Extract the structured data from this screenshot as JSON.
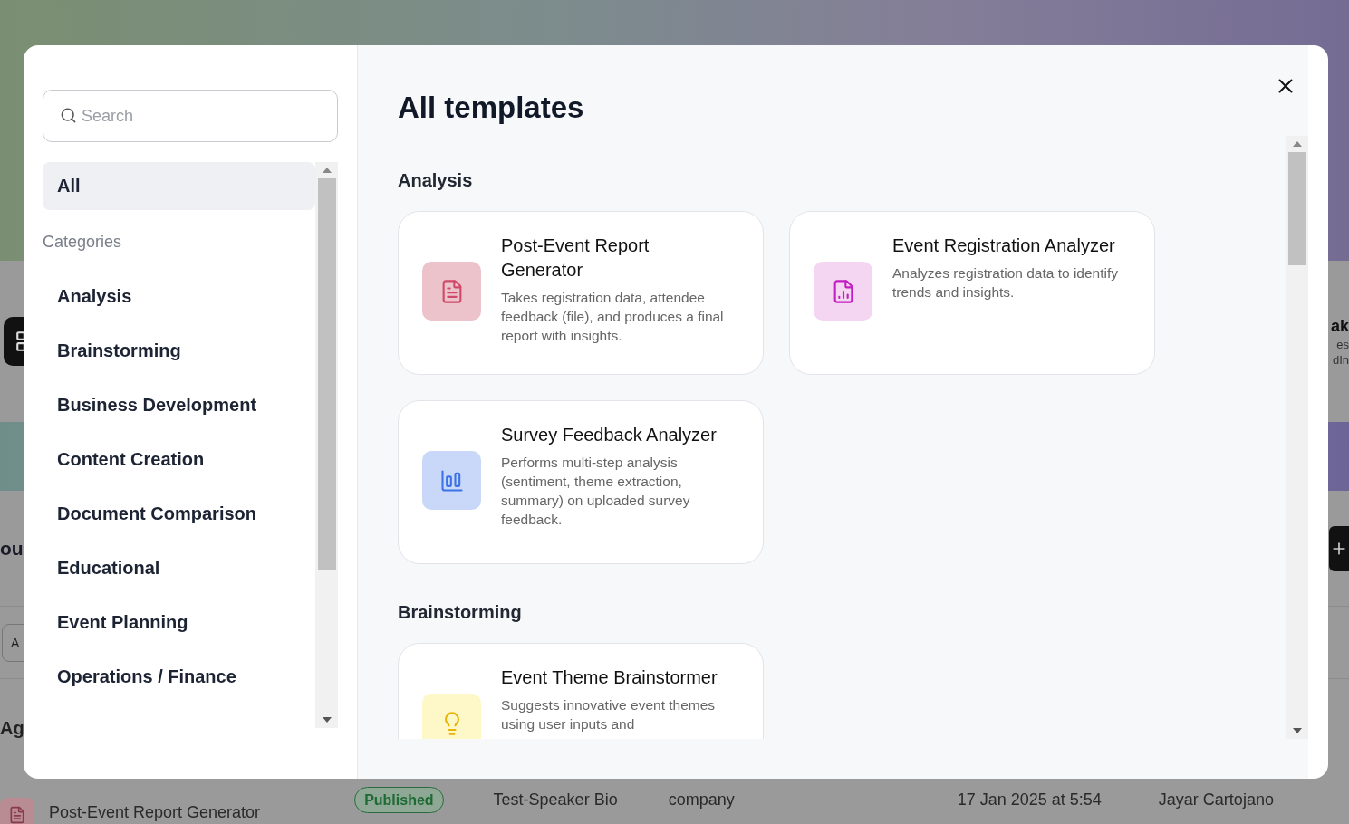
{
  "background": {
    "side_fragments": {
      "right_heading": "ak",
      "right_line_1": "es",
      "right_line_2": "dIn",
      "left_heading": "ou",
      "left_field": "A",
      "left_label": "Ag"
    },
    "row": {
      "name": "Post-Event Report Generator",
      "status": "Published",
      "column_3": "Test-Speaker Bio",
      "column_4": "company",
      "date": "17 Jan 2025 at 5:54",
      "author": "Jayar Cartojano"
    }
  },
  "dialog": {
    "search": {
      "placeholder": "Search"
    },
    "all_item": {
      "label": "All",
      "selected": true
    },
    "categories_label": "Categories",
    "categories": [
      {
        "label": "Analysis",
        "selected": false
      },
      {
        "label": "Brainstorming",
        "selected": false
      },
      {
        "label": "Business Development",
        "selected": false
      },
      {
        "label": "Content Creation",
        "selected": false
      },
      {
        "label": "Document Comparison",
        "selected": false
      },
      {
        "label": "Educational",
        "selected": false
      },
      {
        "label": "Event Planning",
        "selected": false
      },
      {
        "label": "Operations / Finance",
        "selected": false
      }
    ],
    "title": "All templates",
    "sections": [
      {
        "heading": "Analysis",
        "templates": [
          {
            "kind": "report",
            "title": "Post-Event Report Generator",
            "description": "Takes registration data, attendee feedback (file), and produces a final report with insights."
          },
          {
            "kind": "file-chart",
            "title": "Event Registration Analyzer",
            "description": "Analyzes registration data to identify trends and insights."
          },
          {
            "kind": "bars",
            "title": "Survey Feedback Analyzer",
            "description": "Performs multi-step analysis (sentiment, theme extraction, summary) on uploaded survey feedback."
          }
        ]
      },
      {
        "heading": "Brainstorming",
        "templates": [
          {
            "kind": "bulb",
            "title": "Event Theme Brainstormer",
            "description": "Suggests innovative event themes using user inputs and"
          }
        ]
      }
    ]
  }
}
